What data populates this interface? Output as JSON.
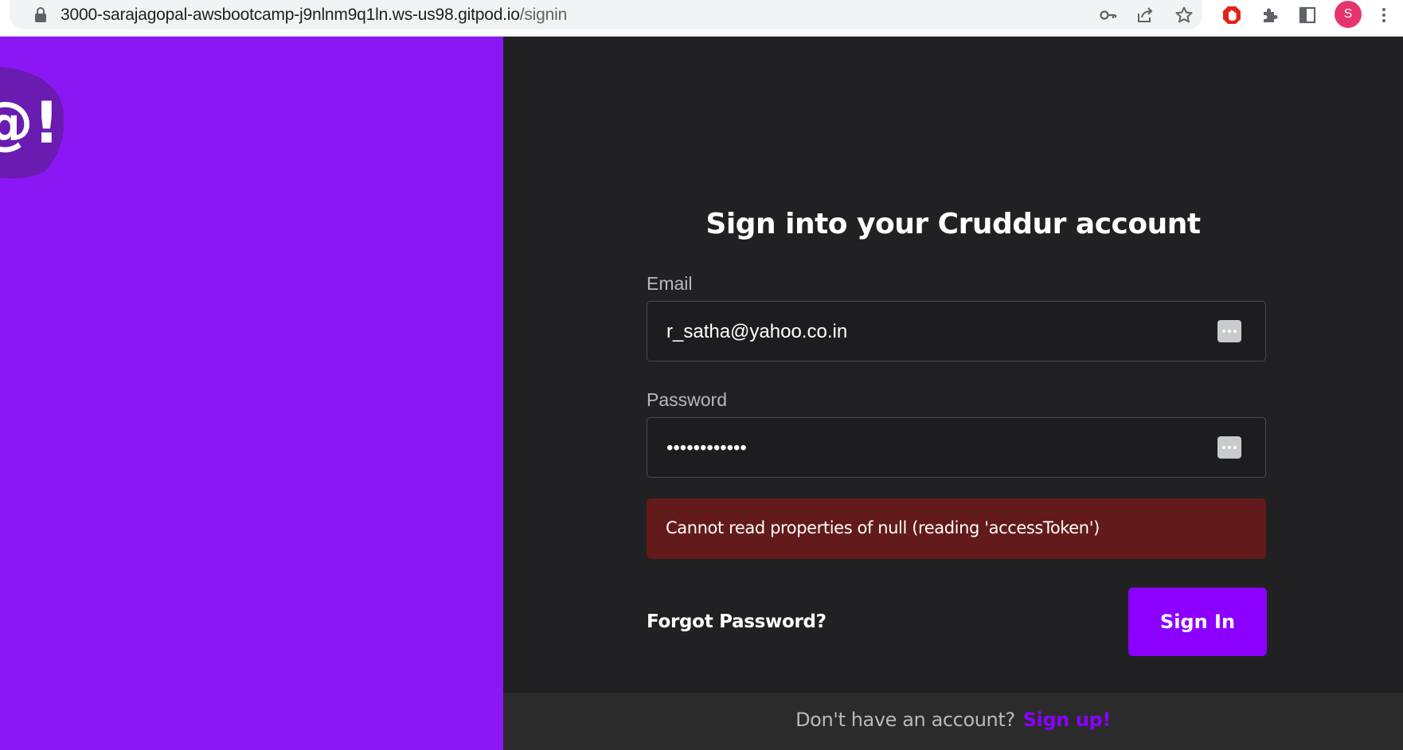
{
  "browser": {
    "url_host": "3000-sarajagopal-awsbootcamp-j9nlnm9q1ln.ws-us98.gitpod.io",
    "url_path": "/signin",
    "avatar_letter": "S",
    "icons": [
      "lock-icon",
      "key-icon",
      "share-icon",
      "star-icon",
      "adblock-icon",
      "extensions-icon",
      "side-panel-icon",
      "more-icon"
    ]
  },
  "brand": {
    "color": "#8b17f5"
  },
  "form": {
    "title": "Sign into your Cruddur account",
    "email_label": "Email",
    "email_value": "r_satha@yahoo.co.in",
    "password_label": "Password",
    "password_value": "••••••••••••",
    "error": "Cannot read properties of null (reading 'accessToken')",
    "forgot_label": "Forgot Password?",
    "submit_label": "Sign In"
  },
  "footer": {
    "prompt": "Don't have an account?",
    "signup_label": "Sign up!"
  },
  "colors": {
    "accent": "#8b00ff",
    "error_bg": "#631a1a",
    "panel_bg": "#212124"
  }
}
